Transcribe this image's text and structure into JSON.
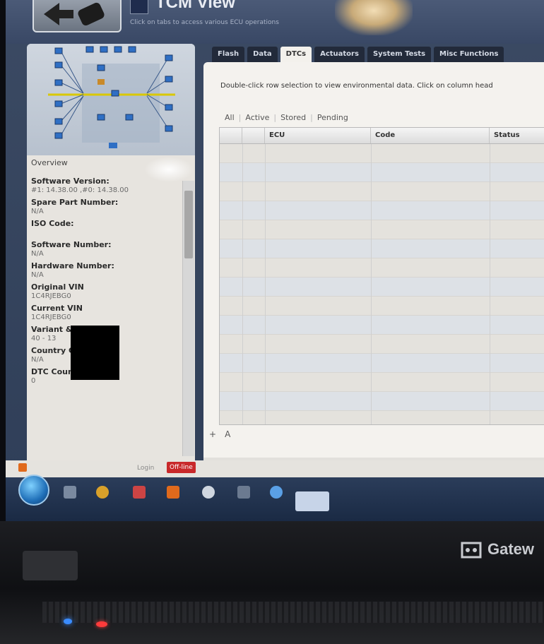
{
  "header": {
    "title": "TCM View",
    "subtitle": "Click on tabs to access various ECU operations"
  },
  "overview_label": "Overview",
  "info": [
    {
      "key": "Software Version:",
      "value": "#1: 14.38.00 ,#0: 14.38.00"
    },
    {
      "key": "Spare Part Number:",
      "value": "N/A"
    },
    {
      "key": "ISO Code:",
      "value": ""
    },
    {
      "key": "Software Number:",
      "value": "N/A"
    },
    {
      "key": "Hardware Number:",
      "value": "N/A"
    },
    {
      "key": "Original VIN",
      "value": "1C4RJEBG0"
    },
    {
      "key": "Current VIN",
      "value": "1C4RJEBG0"
    },
    {
      "key": "Variant & Version:",
      "value": "40 - 13"
    },
    {
      "key": "Country Code",
      "value": "N/A"
    },
    {
      "key": "DTC Count:",
      "value": "0"
    }
  ],
  "tabs": [
    "Flash",
    "Data",
    "DTCs",
    "Actuators",
    "System Tests",
    "Misc Functions"
  ],
  "active_tab": "DTCs",
  "instructions": "Double-click row selection to view environmental data. Click on column head",
  "filters": [
    "All",
    "Active",
    "Stored",
    "Pending"
  ],
  "grid": {
    "columns": [
      "",
      "",
      "ECU",
      "Code",
      "Status"
    ],
    "row_count": 15
  },
  "grid_footer": {
    "add": "+",
    "font": "A"
  },
  "status": {
    "login": "Login",
    "offline": "Off-line"
  },
  "brand": "Gatew",
  "colors": {
    "offline": "#c8282a",
    "taskbar": "#1a2a44",
    "tab_active": "#f3f1ec"
  }
}
